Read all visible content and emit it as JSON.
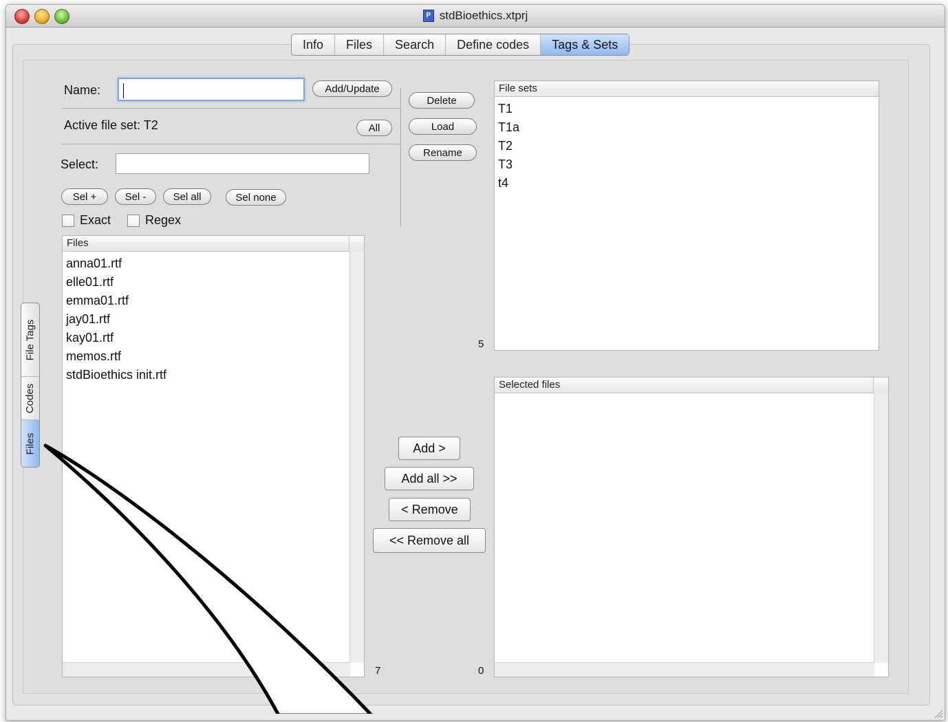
{
  "window": {
    "title": "stdBioethics.xtprj"
  },
  "tabs": [
    {
      "label": "Info"
    },
    {
      "label": "Files"
    },
    {
      "label": "Search"
    },
    {
      "label": "Define codes"
    },
    {
      "label": "Tags & Sets",
      "active": true
    }
  ],
  "form": {
    "name_label": "Name:",
    "name_value": "",
    "add_update_label": "Add/Update",
    "active_label": "Active file set:",
    "active_value": "T2",
    "all_label": "All",
    "select_label": "Select:",
    "select_value": "",
    "sel_plus": "Sel +",
    "sel_minus": "Sel -",
    "sel_all": "Sel all",
    "sel_none": "Sel none",
    "exact_label": "Exact",
    "regex_label": "Regex"
  },
  "set_buttons": {
    "delete": "Delete",
    "load": "Load",
    "rename": "Rename"
  },
  "files_list": {
    "header": "Files",
    "items": [
      "anna01.rtf",
      "elle01.rtf",
      "emma01.rtf",
      "jay01.rtf",
      "kay01.rtf",
      "memos.rtf",
      "stdBioethics init.rtf"
    ],
    "count": "7"
  },
  "file_sets": {
    "header": "File sets",
    "items": [
      "T1",
      "T1a",
      "T2",
      "T3",
      "t4"
    ],
    "count": "5"
  },
  "selected_files": {
    "header": "Selected files",
    "items": [],
    "count": "0"
  },
  "move_buttons": {
    "add": "Add >",
    "add_all": "Add all >>",
    "remove": "< Remove",
    "remove_all": "<< Remove all"
  },
  "side_tabs": [
    {
      "label": "File Tags"
    },
    {
      "label": "Codes"
    },
    {
      "label": "Files",
      "active": true
    }
  ],
  "colors": {
    "accent_tab": "#8fb8ef",
    "window_bg": "#e8e8e8"
  }
}
